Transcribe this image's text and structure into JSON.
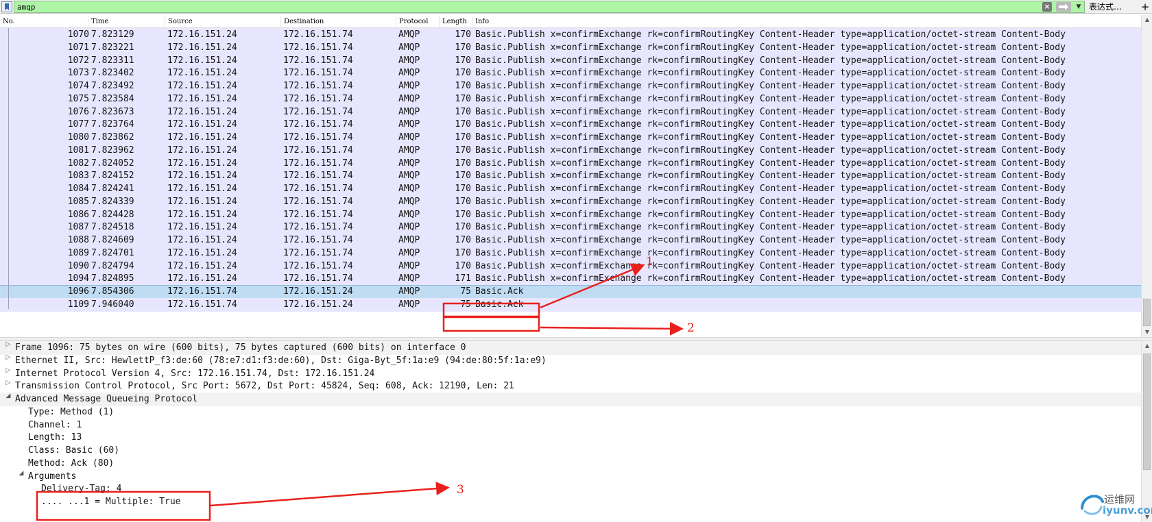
{
  "filter": {
    "value": "amqp",
    "expression_label": "表达式…",
    "add_label": "+"
  },
  "packet_list": {
    "columns": [
      "No.",
      "Time",
      "Source",
      "Destination",
      "Protocol",
      "Length",
      "Info"
    ],
    "rows": [
      {
        "no": "1070",
        "time": "7.823129",
        "src": "172.16.151.24",
        "dst": "172.16.151.74",
        "proto": "AMQP",
        "len": "170",
        "info": "Basic.Publish x=confirmExchange rk=confirmRoutingKey Content-Header type=application/octet-stream Content-Body"
      },
      {
        "no": "1071",
        "time": "7.823221",
        "src": "172.16.151.24",
        "dst": "172.16.151.74",
        "proto": "AMQP",
        "len": "170",
        "info": "Basic.Publish x=confirmExchange rk=confirmRoutingKey Content-Header type=application/octet-stream Content-Body"
      },
      {
        "no": "1072",
        "time": "7.823311",
        "src": "172.16.151.24",
        "dst": "172.16.151.74",
        "proto": "AMQP",
        "len": "170",
        "info": "Basic.Publish x=confirmExchange rk=confirmRoutingKey Content-Header type=application/octet-stream Content-Body"
      },
      {
        "no": "1073",
        "time": "7.823402",
        "src": "172.16.151.24",
        "dst": "172.16.151.74",
        "proto": "AMQP",
        "len": "170",
        "info": "Basic.Publish x=confirmExchange rk=confirmRoutingKey Content-Header type=application/octet-stream Content-Body"
      },
      {
        "no": "1074",
        "time": "7.823492",
        "src": "172.16.151.24",
        "dst": "172.16.151.74",
        "proto": "AMQP",
        "len": "170",
        "info": "Basic.Publish x=confirmExchange rk=confirmRoutingKey Content-Header type=application/octet-stream Content-Body"
      },
      {
        "no": "1075",
        "time": "7.823584",
        "src": "172.16.151.24",
        "dst": "172.16.151.74",
        "proto": "AMQP",
        "len": "170",
        "info": "Basic.Publish x=confirmExchange rk=confirmRoutingKey Content-Header type=application/octet-stream Content-Body"
      },
      {
        "no": "1076",
        "time": "7.823673",
        "src": "172.16.151.24",
        "dst": "172.16.151.74",
        "proto": "AMQP",
        "len": "170",
        "info": "Basic.Publish x=confirmExchange rk=confirmRoutingKey Content-Header type=application/octet-stream Content-Body"
      },
      {
        "no": "1077",
        "time": "7.823764",
        "src": "172.16.151.24",
        "dst": "172.16.151.74",
        "proto": "AMQP",
        "len": "170",
        "info": "Basic.Publish x=confirmExchange rk=confirmRoutingKey Content-Header type=application/octet-stream Content-Body"
      },
      {
        "no": "1080",
        "time": "7.823862",
        "src": "172.16.151.24",
        "dst": "172.16.151.74",
        "proto": "AMQP",
        "len": "170",
        "info": "Basic.Publish x=confirmExchange rk=confirmRoutingKey Content-Header type=application/octet-stream Content-Body"
      },
      {
        "no": "1081",
        "time": "7.823962",
        "src": "172.16.151.24",
        "dst": "172.16.151.74",
        "proto": "AMQP",
        "len": "170",
        "info": "Basic.Publish x=confirmExchange rk=confirmRoutingKey Content-Header type=application/octet-stream Content-Body"
      },
      {
        "no": "1082",
        "time": "7.824052",
        "src": "172.16.151.24",
        "dst": "172.16.151.74",
        "proto": "AMQP",
        "len": "170",
        "info": "Basic.Publish x=confirmExchange rk=confirmRoutingKey Content-Header type=application/octet-stream Content-Body"
      },
      {
        "no": "1083",
        "time": "7.824152",
        "src": "172.16.151.24",
        "dst": "172.16.151.74",
        "proto": "AMQP",
        "len": "170",
        "info": "Basic.Publish x=confirmExchange rk=confirmRoutingKey Content-Header type=application/octet-stream Content-Body"
      },
      {
        "no": "1084",
        "time": "7.824241",
        "src": "172.16.151.24",
        "dst": "172.16.151.74",
        "proto": "AMQP",
        "len": "170",
        "info": "Basic.Publish x=confirmExchange rk=confirmRoutingKey Content-Header type=application/octet-stream Content-Body"
      },
      {
        "no": "1085",
        "time": "7.824339",
        "src": "172.16.151.24",
        "dst": "172.16.151.74",
        "proto": "AMQP",
        "len": "170",
        "info": "Basic.Publish x=confirmExchange rk=confirmRoutingKey Content-Header type=application/octet-stream Content-Body"
      },
      {
        "no": "1086",
        "time": "7.824428",
        "src": "172.16.151.24",
        "dst": "172.16.151.74",
        "proto": "AMQP",
        "len": "170",
        "info": "Basic.Publish x=confirmExchange rk=confirmRoutingKey Content-Header type=application/octet-stream Content-Body"
      },
      {
        "no": "1087",
        "time": "7.824518",
        "src": "172.16.151.24",
        "dst": "172.16.151.74",
        "proto": "AMQP",
        "len": "170",
        "info": "Basic.Publish x=confirmExchange rk=confirmRoutingKey Content-Header type=application/octet-stream Content-Body"
      },
      {
        "no": "1088",
        "time": "7.824609",
        "src": "172.16.151.24",
        "dst": "172.16.151.74",
        "proto": "AMQP",
        "len": "170",
        "info": "Basic.Publish x=confirmExchange rk=confirmRoutingKey Content-Header type=application/octet-stream Content-Body"
      },
      {
        "no": "1089",
        "time": "7.824701",
        "src": "172.16.151.24",
        "dst": "172.16.151.74",
        "proto": "AMQP",
        "len": "170",
        "info": "Basic.Publish x=confirmExchange rk=confirmRoutingKey Content-Header type=application/octet-stream Content-Body"
      },
      {
        "no": "1090",
        "time": "7.824794",
        "src": "172.16.151.24",
        "dst": "172.16.151.74",
        "proto": "AMQP",
        "len": "170",
        "info": "Basic.Publish x=confirmExchange rk=confirmRoutingKey Content-Header type=application/octet-stream Content-Body"
      },
      {
        "no": "1094",
        "time": "7.824895",
        "src": "172.16.151.24",
        "dst": "172.16.151.74",
        "proto": "AMQP",
        "len": "171",
        "info": "Basic.Publish x=confirmExchange rk=confirmRoutingKey Content-Header type=application/octet-stream Content-Body"
      },
      {
        "no": "1096",
        "time": "7.854306",
        "src": "172.16.151.74",
        "dst": "172.16.151.24",
        "proto": "AMQP",
        "len": "75",
        "info": "Basic.Ack",
        "selected": true
      },
      {
        "no": "1109",
        "time": "7.946040",
        "src": "172.16.151.74",
        "dst": "172.16.151.24",
        "proto": "AMQP",
        "len": "75",
        "info": "Basic.Ack"
      }
    ]
  },
  "packet_details": {
    "rows": [
      {
        "text": "Frame 1096: 75 bytes on wire (600 bits), 75 bytes captured (600 bits) on interface 0",
        "level": 0,
        "expander": "collapsed",
        "shaded": true
      },
      {
        "text": "Ethernet II, Src: HewlettP_f3:de:60 (78:e7:d1:f3:de:60), Dst: Giga-Byt_5f:1a:e9 (94:de:80:5f:1a:e9)",
        "level": 0,
        "expander": "collapsed",
        "shaded": false
      },
      {
        "text": "Internet Protocol Version 4, Src: 172.16.151.74, Dst: 172.16.151.24",
        "level": 0,
        "expander": "collapsed",
        "shaded": false
      },
      {
        "text": "Transmission Control Protocol, Src Port: 5672, Dst Port: 45824, Seq: 608, Ack: 12190, Len: 21",
        "level": 0,
        "expander": "collapsed",
        "shaded": false
      },
      {
        "text": "Advanced Message Queueing Protocol",
        "level": 0,
        "expander": "expanded",
        "shaded": true
      },
      {
        "text": "Type: Method (1)",
        "level": 1,
        "expander": "none",
        "shaded": false
      },
      {
        "text": "Channel: 1",
        "level": 1,
        "expander": "none",
        "shaded": false
      },
      {
        "text": "Length: 13",
        "level": 1,
        "expander": "none",
        "shaded": false
      },
      {
        "text": "Class: Basic (60)",
        "level": 1,
        "expander": "none",
        "shaded": false
      },
      {
        "text": "Method: Ack (80)",
        "level": 1,
        "expander": "none",
        "shaded": false
      },
      {
        "text": "Arguments",
        "level": 1,
        "expander": "expanded",
        "shaded": false
      },
      {
        "text": "Delivery-Tag: 4",
        "level": 2,
        "expander": "none",
        "shaded": false
      },
      {
        "text": ".... ...1 = Multiple: True",
        "level": 2,
        "expander": "none",
        "shaded": false
      }
    ]
  },
  "annotations": {
    "labels": [
      "1",
      "2",
      "3"
    ],
    "color": "#e8211c"
  },
  "colors": {
    "filter_valid": "#aff5a7",
    "row_amqp": "#e7e6fe",
    "row_selected": "#c0dcf3",
    "annotation": "#e8211c"
  },
  "watermark": {
    "cn": "运维网",
    "en": "iyunv.com"
  }
}
